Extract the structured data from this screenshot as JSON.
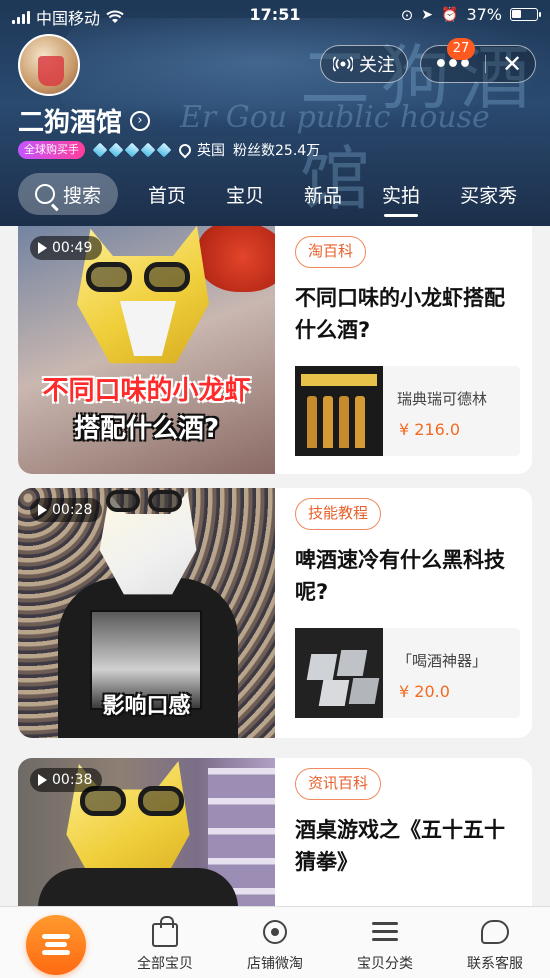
{
  "status_bar": {
    "carrier": "中国移动",
    "time": "17:51",
    "battery_percent": "37%",
    "battery_level": 0.37
  },
  "header": {
    "shop_name": "二狗酒馆",
    "follow_label": "关注",
    "more_badge": "27",
    "global_tag": "全球购买手",
    "diamond_count": 5,
    "location": "英国",
    "fans": "粉丝数25.4万",
    "sign_text": "二狗酒馆",
    "sign_sub": "Er Gou public house"
  },
  "tabs": {
    "search": "搜索",
    "items": [
      "首页",
      "宝贝",
      "新品",
      "实拍",
      "买家秀"
    ],
    "active_index": 3
  },
  "feed": [
    {
      "duration": "00:49",
      "overlay_line1": "不同口味的小龙虾",
      "overlay_line2": "搭配什么酒?",
      "tag": "淘百科",
      "title": "不同口味的小龙虾搭配什么酒?",
      "product_name": "瑞典瑞可德林",
      "product_price": "¥ 216.0"
    },
    {
      "duration": "00:28",
      "overlay_line1": "",
      "overlay_line2": "影响口感",
      "tag": "技能教程",
      "title": "啤酒速冷有什么黑科技呢?",
      "product_name": "「喝酒神器」",
      "product_price": "¥ 20.0"
    },
    {
      "duration": "00:38",
      "overlay_line1": "",
      "overlay_line2": "",
      "tag": "资讯百科",
      "title": "酒桌游戏之《五十五十猜拳》",
      "product_name": "",
      "product_price": ""
    }
  ],
  "bottom_nav": {
    "items": [
      "全部宝贝",
      "店铺微淘",
      "宝贝分类",
      "联系客服"
    ]
  },
  "colors": {
    "accent": "#ff6a12",
    "tag_border": "#f08a5d",
    "price": "#f26b21",
    "header_bg": "#223c5e"
  },
  "icons": {
    "home": "burger-menu-icon",
    "all_items": "shopping-bag-icon",
    "weitao": "broadcast-icon",
    "category": "list-icon",
    "service": "chat-bubble-icon"
  }
}
